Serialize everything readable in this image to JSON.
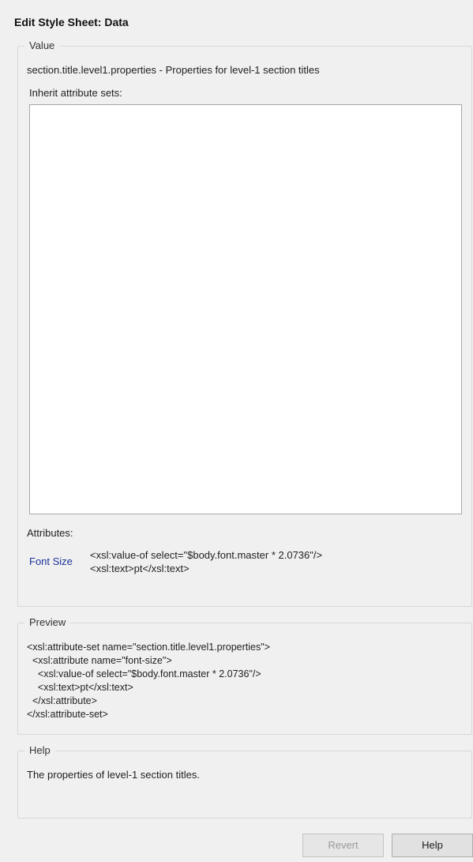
{
  "dialog": {
    "title": "Edit Style Sheet: Data"
  },
  "value_group": {
    "legend": "Value",
    "description": "section.title.level1.properties - Properties for level-1 section titles",
    "inherit_label": "Inherit attribute sets:",
    "inherit_items": [],
    "attributes_label": "Attributes:",
    "attributes": [
      {
        "name": "Font Size",
        "value_lines": [
          "<xsl:value-of select=\"$body.font.master * 2.0736\"/>",
          "<xsl:text>pt</xsl:text>"
        ]
      }
    ]
  },
  "preview_group": {
    "legend": "Preview",
    "lines": [
      "<xsl:attribute-set name=\"section.title.level1.properties\">",
      "  <xsl:attribute name=\"font-size\">",
      "    <xsl:value-of select=\"$body.font.master * 2.0736\"/>",
      "    <xsl:text>pt</xsl:text>",
      "  </xsl:attribute>",
      "</xsl:attribute-set>"
    ]
  },
  "help_group": {
    "legend": "Help",
    "text": "The properties of level-1 section titles."
  },
  "buttons": {
    "revert": {
      "label": "Revert",
      "enabled": false
    },
    "help": {
      "label": "Help",
      "enabled": true
    }
  }
}
